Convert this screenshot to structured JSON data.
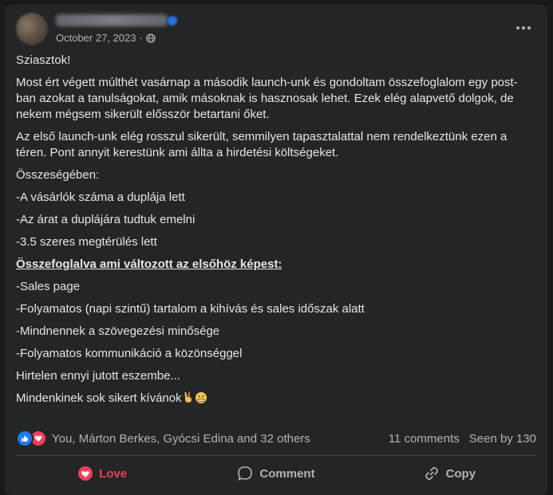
{
  "post": {
    "date": "October 27, 2023",
    "dot": "·",
    "paragraphs": [
      "Sziasztok!",
      "Most ért végett múlthét vasárnap a második launch-unk és gondoltam összefoglalom egy post-ban azokat a tanulságokat, amik másoknak is hasznosak lehet. Ezek elég alapvető dolgok, de nekem mégsem sikerült elősször betartani őket.",
      "Az első launch-unk elég rosszul sikerült, semmilyen tapasztalattal nem rendelkeztünk ezen a téren. Pont annyit kerestünk ami állta a hirdetési költségeket.",
      "Összeségében:",
      "-A vásárlók száma a duplája lett",
      "-Az árat a duplájára tudtuk emelni",
      "-3.5 szeres megtérülés lett",
      "Összefoglalva ami változott az elsőhöz képest:",
      "-Sales page",
      "-Folyamatos (napi szintű) tartalom a kihívás és sales időszak alatt",
      "-Mindnennek a szövegezési minősége",
      "-Folyamatos kommunikáció a közönséggel",
      "Hirtelen ennyi jutott eszembe...",
      "Mindenkinek sok sikert kívánok"
    ]
  },
  "reactions": {
    "summary": "You, Márton Berkes, Gyócsi Edina and 32 others",
    "comments": "11 comments",
    "seen": "Seen by 130"
  },
  "actions": {
    "love": "Love",
    "comment": "Comment",
    "copy": "Copy"
  },
  "colors": {
    "background": "#242526",
    "love": "#f33e58",
    "like": "#2078f4"
  }
}
